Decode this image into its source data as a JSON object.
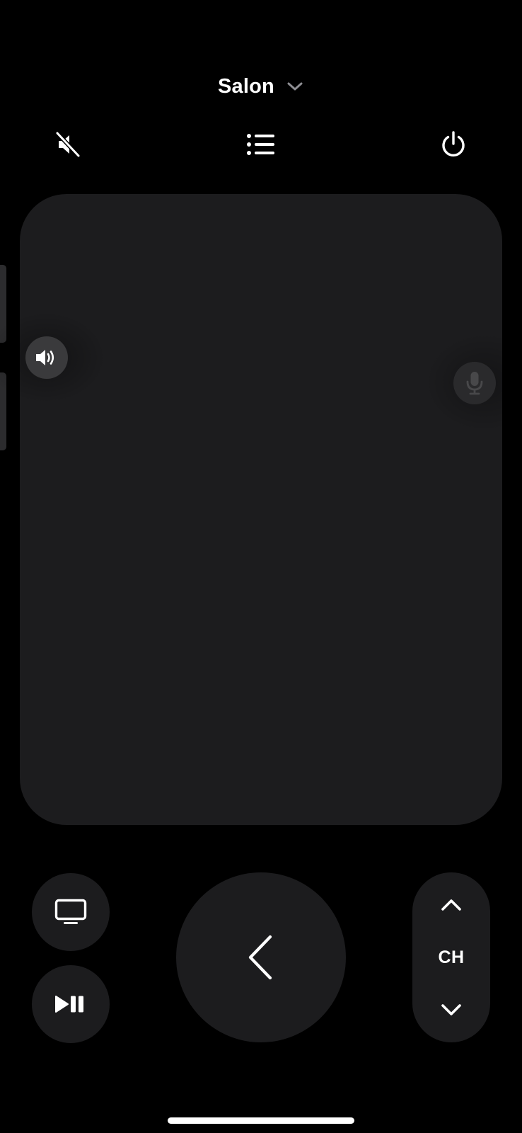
{
  "header": {
    "device_name": "Salon"
  },
  "icons": {
    "device_chevron": "chevron-down-icon",
    "mute": "speaker-muted-icon",
    "list": "list-icon",
    "power": "power-icon",
    "volume": "speaker-volume-icon",
    "mic": "microphone-icon",
    "tv": "tv-icon",
    "play_pause": "play-pause-icon",
    "back": "chevron-left-icon",
    "channel_up": "chevron-up-icon",
    "channel_down": "chevron-down-icon"
  },
  "channel": {
    "label": "CH"
  },
  "colors": {
    "background": "#000000",
    "surface": "#1c1c1e",
    "handle": "#3a3a3c",
    "icon": "#ffffff",
    "chevron_muted": "#8e8e93"
  }
}
